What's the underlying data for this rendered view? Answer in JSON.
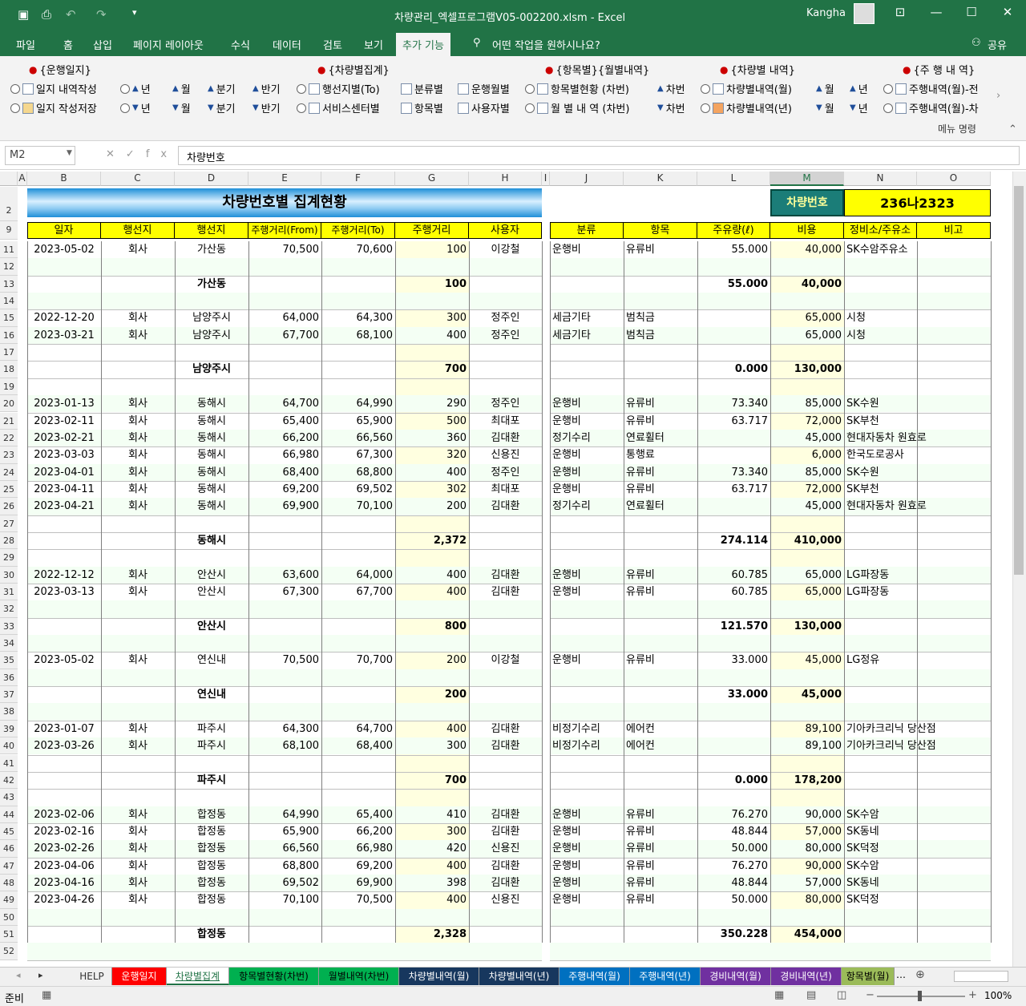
{
  "window": {
    "title": "차량관리_엑셀프로그램V05-002200.xlsm  -  Excel",
    "user": "Kangha"
  },
  "ribbon_tabs": [
    "파일",
    "홈",
    "삽입",
    "페이지 레이아웃",
    "수식",
    "데이터",
    "검토",
    "보기",
    "추가 기능"
  ],
  "tell_me": "어떤 작업을 원하시나요?",
  "share": "공유",
  "groups": {
    "g1": {
      "title": "{운행일지}",
      "r1": "일지 내역작성",
      "r2": "일지 작성저장",
      "y1": "년",
      "m1": "월",
      "q1": "분기",
      "h1": "반기",
      "y2": "년",
      "m2": "월",
      "q2": "분기",
      "h2": "반기"
    },
    "g2": {
      "title": "{차량별집계}",
      "a1": "행선지별(To)",
      "a2": "분류별",
      "a3": "운행월별",
      "b1": "서비스센터별",
      "b2": "항목별",
      "b3": "사용자별"
    },
    "g3": {
      "title": "{항목별}{월별내역}",
      "a1": "항목별현황 (차번)",
      "a2": "차번",
      "b1": "월 별 내 역 (차번)",
      "b2": "차번"
    },
    "g4": {
      "title": "{차량별 내역}",
      "a1": "차량별내역(월)",
      "a2": "월",
      "a3": "년",
      "b1": "차량별내역(년)",
      "b2": "월",
      "b3": "년"
    },
    "g5": {
      "title": "{주 행 내 역}",
      "a1": "주행내역(월)-전",
      "b1": "주행내역(월)-차"
    }
  },
  "menu_command": "메뉴 명령",
  "formula": {
    "namebox": "M2",
    "value": "차량번호"
  },
  "columns": [
    "A",
    "B",
    "C",
    "D",
    "E",
    "F",
    "G",
    "H",
    "I",
    "J",
    "K",
    "L",
    "M",
    "N",
    "O"
  ],
  "sheet": {
    "banner": "차량번호별 집계현황",
    "car_label": "차량번호",
    "car_value": "236나2323",
    "headers_left": [
      "일자",
      "행선지",
      "행선지",
      "주행거리(From)",
      "주행거리(To)",
      "주행거리",
      "사용자"
    ],
    "headers_right": [
      "분류",
      "항목",
      "주유량(ℓ)",
      "비용",
      "정비소/주유소",
      "비고"
    ],
    "rows": [
      {
        "n": "11",
        "date": "2023-05-02",
        "from": "회사",
        "to": "가산동",
        "km1": "70,500",
        "km2": "70,600",
        "dist": "100",
        "user": "이강철",
        "cls": "운행비",
        "item": "유류비",
        "fuel": "55.000",
        "cost": "40,000",
        "shop": "SK수암주유소"
      },
      {
        "n": "12"
      },
      {
        "n": "13",
        "to": "가산동",
        "dist": "100",
        "fuel": "55.000",
        "cost": "40,000",
        "sub": true
      },
      {
        "n": "14"
      },
      {
        "n": "15",
        "date": "2022-12-20",
        "from": "회사",
        "to": "남양주시",
        "km1": "64,000",
        "km2": "64,300",
        "dist": "300",
        "user": "정주인",
        "cls": "세금기타",
        "item": "범칙금",
        "cost": "65,000",
        "shop": "시청"
      },
      {
        "n": "16",
        "date": "2023-03-21",
        "from": "회사",
        "to": "남양주시",
        "km1": "67,700",
        "km2": "68,100",
        "dist": "400",
        "user": "정주인",
        "cls": "세금기타",
        "item": "범칙금",
        "cost": "65,000",
        "shop": "시청"
      },
      {
        "n": "17"
      },
      {
        "n": "18",
        "to": "남양주시",
        "dist": "700",
        "fuel": "0.000",
        "cost": "130,000",
        "sub": true
      },
      {
        "n": "19"
      },
      {
        "n": "20",
        "date": "2023-01-13",
        "from": "회사",
        "to": "동해시",
        "km1": "64,700",
        "km2": "64,990",
        "dist": "290",
        "user": "정주인",
        "cls": "운행비",
        "item": "유류비",
        "fuel": "73.340",
        "cost": "85,000",
        "shop": "SK수원"
      },
      {
        "n": "21",
        "date": "2023-02-11",
        "from": "회사",
        "to": "동해시",
        "km1": "65,400",
        "km2": "65,900",
        "dist": "500",
        "user": "최대포",
        "cls": "운행비",
        "item": "유류비",
        "fuel": "63.717",
        "cost": "72,000",
        "shop": "SK부천"
      },
      {
        "n": "22",
        "date": "2023-02-21",
        "from": "회사",
        "to": "동해시",
        "km1": "66,200",
        "km2": "66,560",
        "dist": "360",
        "user": "김대환",
        "cls": "정기수리",
        "item": "연료휠터",
        "cost": "45,000",
        "shop": "현대자동차 원효로"
      },
      {
        "n": "23",
        "date": "2023-03-03",
        "from": "회사",
        "to": "동해시",
        "km1": "66,980",
        "km2": "67,300",
        "dist": "320",
        "user": "신용진",
        "cls": "운행비",
        "item": "통행료",
        "cost": "6,000",
        "shop": "한국도로공사"
      },
      {
        "n": "24",
        "date": "2023-04-01",
        "from": "회사",
        "to": "동해시",
        "km1": "68,400",
        "km2": "68,800",
        "dist": "400",
        "user": "정주인",
        "cls": "운행비",
        "item": "유류비",
        "fuel": "73.340",
        "cost": "85,000",
        "shop": "SK수원"
      },
      {
        "n": "25",
        "date": "2023-04-11",
        "from": "회사",
        "to": "동해시",
        "km1": "69,200",
        "km2": "69,502",
        "dist": "302",
        "user": "최대포",
        "cls": "운행비",
        "item": "유류비",
        "fuel": "63.717",
        "cost": "72,000",
        "shop": "SK부천"
      },
      {
        "n": "26",
        "date": "2023-04-21",
        "from": "회사",
        "to": "동해시",
        "km1": "69,900",
        "km2": "70,100",
        "dist": "200",
        "user": "김대환",
        "cls": "정기수리",
        "item": "연료휠터",
        "cost": "45,000",
        "shop": "현대자동차 원효로"
      },
      {
        "n": "27"
      },
      {
        "n": "28",
        "to": "동해시",
        "dist": "2,372",
        "fuel": "274.114",
        "cost": "410,000",
        "sub": true
      },
      {
        "n": "29"
      },
      {
        "n": "30",
        "date": "2022-12-12",
        "from": "회사",
        "to": "안산시",
        "km1": "63,600",
        "km2": "64,000",
        "dist": "400",
        "user": "김대환",
        "cls": "운행비",
        "item": "유류비",
        "fuel": "60.785",
        "cost": "65,000",
        "shop": "LG파장동"
      },
      {
        "n": "31",
        "date": "2023-03-13",
        "from": "회사",
        "to": "안산시",
        "km1": "67,300",
        "km2": "67,700",
        "dist": "400",
        "user": "김대환",
        "cls": "운행비",
        "item": "유류비",
        "fuel": "60.785",
        "cost": "65,000",
        "shop": "LG파장동"
      },
      {
        "n": "32"
      },
      {
        "n": "33",
        "to": "안산시",
        "dist": "800",
        "fuel": "121.570",
        "cost": "130,000",
        "sub": true
      },
      {
        "n": "34"
      },
      {
        "n": "35",
        "date": "2023-05-02",
        "from": "회사",
        "to": "연신내",
        "km1": "70,500",
        "km2": "70,700",
        "dist": "200",
        "user": "이강철",
        "cls": "운행비",
        "item": "유류비",
        "fuel": "33.000",
        "cost": "45,000",
        "shop": "LG정유"
      },
      {
        "n": "36"
      },
      {
        "n": "37",
        "to": "연신내",
        "dist": "200",
        "fuel": "33.000",
        "cost": "45,000",
        "sub": true
      },
      {
        "n": "38"
      },
      {
        "n": "39",
        "date": "2023-01-07",
        "from": "회사",
        "to": "파주시",
        "km1": "64,300",
        "km2": "64,700",
        "dist": "400",
        "user": "김대환",
        "cls": "비정기수리",
        "item": "에어컨",
        "cost": "89,100",
        "shop": "기아카크리닉 당산점"
      },
      {
        "n": "40",
        "date": "2023-03-26",
        "from": "회사",
        "to": "파주시",
        "km1": "68,100",
        "km2": "68,400",
        "dist": "300",
        "user": "김대환",
        "cls": "비정기수리",
        "item": "에어컨",
        "cost": "89,100",
        "shop": "기아카크리닉 당산점"
      },
      {
        "n": "41"
      },
      {
        "n": "42",
        "to": "파주시",
        "dist": "700",
        "fuel": "0.000",
        "cost": "178,200",
        "sub": true
      },
      {
        "n": "43"
      },
      {
        "n": "44",
        "date": "2023-02-06",
        "from": "회사",
        "to": "합정동",
        "km1": "64,990",
        "km2": "65,400",
        "dist": "410",
        "user": "김대환",
        "cls": "운행비",
        "item": "유류비",
        "fuel": "76.270",
        "cost": "90,000",
        "shop": "SK수암"
      },
      {
        "n": "45",
        "date": "2023-02-16",
        "from": "회사",
        "to": "합정동",
        "km1": "65,900",
        "km2": "66,200",
        "dist": "300",
        "user": "김대환",
        "cls": "운행비",
        "item": "유류비",
        "fuel": "48.844",
        "cost": "57,000",
        "shop": "SK동네"
      },
      {
        "n": "46",
        "date": "2023-02-26",
        "from": "회사",
        "to": "합정동",
        "km1": "66,560",
        "km2": "66,980",
        "dist": "420",
        "user": "신용진",
        "cls": "운행비",
        "item": "유류비",
        "fuel": "50.000",
        "cost": "80,000",
        "shop": "SK덕정"
      },
      {
        "n": "47",
        "date": "2023-04-06",
        "from": "회사",
        "to": "합정동",
        "km1": "68,800",
        "km2": "69,200",
        "dist": "400",
        "user": "김대환",
        "cls": "운행비",
        "item": "유류비",
        "fuel": "76.270",
        "cost": "90,000",
        "shop": "SK수암"
      },
      {
        "n": "48",
        "date": "2023-04-16",
        "from": "회사",
        "to": "합정동",
        "km1": "69,502",
        "km2": "69,900",
        "dist": "398",
        "user": "김대환",
        "cls": "운행비",
        "item": "유류비",
        "fuel": "48.844",
        "cost": "57,000",
        "shop": "SK동네"
      },
      {
        "n": "49",
        "date": "2023-04-26",
        "from": "회사",
        "to": "합정동",
        "km1": "70,100",
        "km2": "70,500",
        "dist": "400",
        "user": "신용진",
        "cls": "운행비",
        "item": "유류비",
        "fuel": "50.000",
        "cost": "80,000",
        "shop": "SK덕정"
      },
      {
        "n": "50"
      },
      {
        "n": "51",
        "to": "합정동",
        "dist": "2,328",
        "fuel": "350.228",
        "cost": "454,000",
        "sub": true
      },
      {
        "n": "52"
      }
    ]
  },
  "sheet_tabs": [
    {
      "label": "HELP",
      "color": "#f0f0f0",
      "text": "#333"
    },
    {
      "label": "운행일지",
      "color": "#ff0000",
      "text": "#fff"
    },
    {
      "label": "차량별집계",
      "color": "#ffffff",
      "text": "#217346"
    },
    {
      "label": "항목별현황(차번)",
      "color": "#00b050",
      "text": "#000"
    },
    {
      "label": "월별내역(차번)",
      "color": "#00b050",
      "text": "#000"
    },
    {
      "label": "차량별내역(월)",
      "color": "#17375e",
      "text": "#fff"
    },
    {
      "label": "차량별내역(년)",
      "color": "#17375e",
      "text": "#fff"
    },
    {
      "label": "주행내역(월)",
      "color": "#0070c0",
      "text": "#fff"
    },
    {
      "label": "주행내역(년)",
      "color": "#0070c0",
      "text": "#fff"
    },
    {
      "label": "경비내역(월)",
      "color": "#7030a0",
      "text": "#fff"
    },
    {
      "label": "경비내역(년)",
      "color": "#7030a0",
      "text": "#fff"
    },
    {
      "label": "항목별(월)",
      "color": "#9bbb59",
      "text": "#000"
    }
  ],
  "status": {
    "ready": "준비",
    "zoom": "100%"
  }
}
